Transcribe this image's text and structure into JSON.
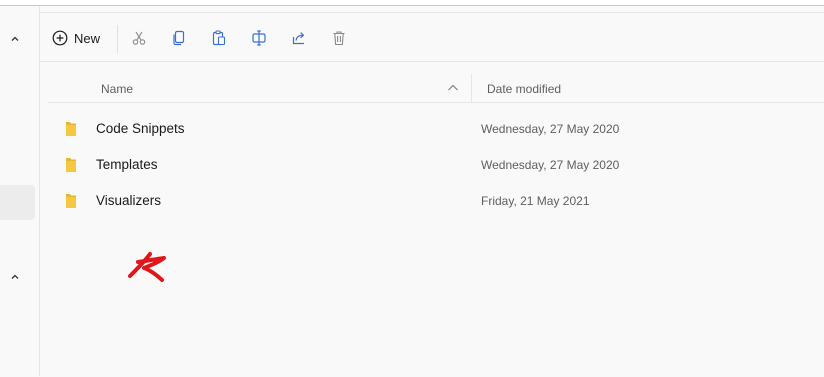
{
  "toolbar": {
    "new_label": "New",
    "actions": [
      "cut-icon",
      "copy-icon",
      "paste-icon",
      "rename-icon",
      "share-icon",
      "delete-icon"
    ]
  },
  "columns": {
    "name": "Name",
    "date_modified": "Date modified"
  },
  "files": [
    {
      "name": "Code Snippets",
      "date": "Wednesday, 27 May 2020"
    },
    {
      "name": "Templates",
      "date": "Wednesday, 27 May 2020"
    },
    {
      "name": "Visualizers",
      "date": "Friday, 21 May 2021"
    }
  ],
  "colors": {
    "folder": "#f5c742",
    "accent_icons": "#3b6fd4",
    "annotation": "#e0161b"
  }
}
